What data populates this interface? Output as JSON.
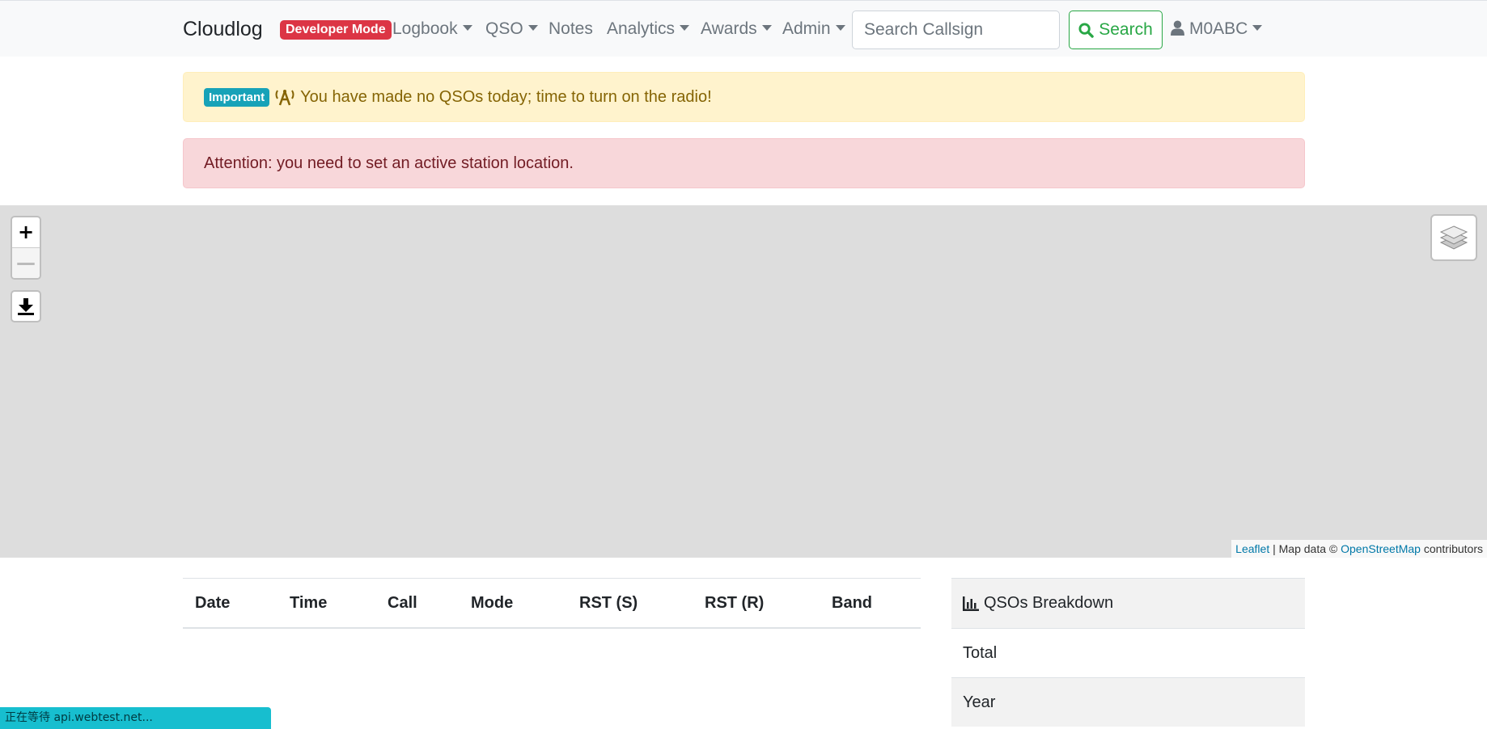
{
  "navbar": {
    "brand": "Cloudlog",
    "dev_badge": "Developer Mode",
    "items": [
      {
        "label": "Logbook"
      },
      {
        "label": "QSO"
      },
      {
        "label": "Notes"
      },
      {
        "label": "Analytics"
      },
      {
        "label": "Awards"
      },
      {
        "label": "Admin"
      }
    ],
    "search": {
      "placeholder": "Search Callsign",
      "value": "",
      "button_label": "Search"
    },
    "user": {
      "label": "M0ABC"
    }
  },
  "alerts": {
    "important": {
      "badge": "Important",
      "message": "You have made no QSOs today; time to turn on the radio!",
      "icon": "broadcast-tower-icon"
    },
    "attention": {
      "message": "Attention: you need to set an active station location."
    }
  },
  "map": {
    "zoom_in": "+",
    "zoom_out": "—",
    "attribution": {
      "leaflet": "Leaflet",
      "separator": " | Map data © ",
      "osm": "OpenStreetMap",
      "suffix": " contributors"
    }
  },
  "qso_table": {
    "columns": [
      "Date",
      "Time",
      "Call",
      "Mode",
      "RST (S)",
      "RST (R)",
      "Band"
    ],
    "rows": []
  },
  "breakdown": {
    "title": "QSOs Breakdown",
    "rows": [
      {
        "label": "Total"
      },
      {
        "label": "Year"
      }
    ]
  },
  "browser_status": "正在等待 api.webtest.net...",
  "colors": {
    "danger": "#dc3545",
    "success": "#28a745",
    "info": "#17a2b8",
    "warning_bg": "#fff3cd",
    "danger_bg": "#f8d7da",
    "map_bg": "#dddddd"
  }
}
